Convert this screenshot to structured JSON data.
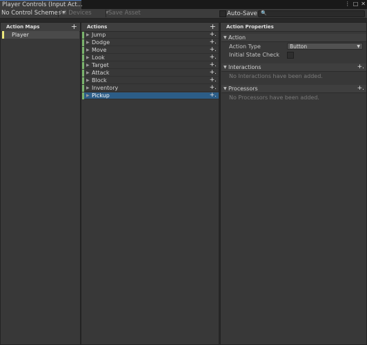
{
  "window": {
    "tab_title": "Player Controls (Input Act...",
    "controls": {
      "menu": "⋮",
      "maximize": "□",
      "close": "✕"
    }
  },
  "toolbar": {
    "control_scheme": "No Control Schemes",
    "devices": "All Devices",
    "save_asset": "Save Asset",
    "auto_save_label": "Auto-Save",
    "auto_save_checked": false,
    "search_value": ""
  },
  "action_maps": {
    "title": "Action Maps",
    "items": [
      {
        "label": "Player",
        "color": "#ece87c"
      }
    ]
  },
  "actions": {
    "title": "Actions",
    "items": [
      {
        "label": "Jump"
      },
      {
        "label": "Dodge"
      },
      {
        "label": "Move"
      },
      {
        "label": "Look"
      },
      {
        "label": "Target"
      },
      {
        "label": "Attack"
      },
      {
        "label": "Block"
      },
      {
        "label": "Inventory"
      },
      {
        "label": "Pickup",
        "selected": true
      }
    ]
  },
  "properties": {
    "title": "Action Properties",
    "action_section": "Action",
    "action_type_label": "Action Type",
    "action_type_value": "Button",
    "initial_state_label": "Initial State Check",
    "initial_state_checked": false,
    "interactions_section": "Interactions",
    "interactions_empty": "No Interactions have been added.",
    "processors_section": "Processors",
    "processors_empty": "No Processors have been added."
  }
}
